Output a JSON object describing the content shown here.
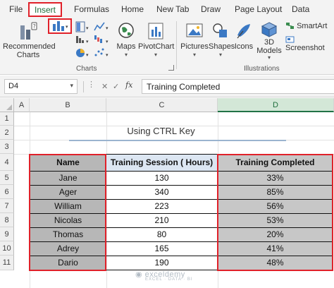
{
  "ribbon_tabs": [
    "File",
    "Insert",
    "Formulas",
    "Home",
    "New Tab",
    "Draw",
    "Page Layout",
    "Data"
  ],
  "active_tab": "Insert",
  "ribbon": {
    "recommended_charts_line1": "Recommended",
    "recommended_charts_line2": "Charts",
    "maps": "Maps",
    "pivotchart": "PivotChart",
    "charts_group": "Charts",
    "pictures": "Pictures",
    "shapes": "Shapes",
    "icons": "Icons",
    "models_3d_line1": "3D",
    "models_3d_line2": "Models",
    "smartart": "SmartArt",
    "screenshot": "Screenshot",
    "illustrations_group": "Illustrations"
  },
  "formula_bar": {
    "name_box": "D4",
    "formula": "Training Completed",
    "cancel_icon": "close-icon",
    "enter_icon": "check-icon",
    "fx_label": "fx"
  },
  "columns": [
    "A",
    "B",
    "C",
    "D"
  ],
  "rows": [
    "1",
    "2",
    "3",
    "4",
    "5",
    "6",
    "7",
    "8",
    "9",
    "10",
    "11"
  ],
  "selected_column": "D",
  "sheet": {
    "title": "Using CTRL Key",
    "headers": [
      "Name",
      "Training Session ( Hours)",
      "Training Completed"
    ],
    "records": [
      [
        "Jane",
        "130",
        "33%"
      ],
      [
        "Ager",
        "340",
        "85%"
      ],
      [
        "William",
        "223",
        "56%"
      ],
      [
        "Nicolas",
        "210",
        "53%"
      ],
      [
        "Thomas",
        "80",
        "20%"
      ],
      [
        "Adrey",
        "165",
        "41%"
      ],
      [
        "Dario",
        "190",
        "48%"
      ]
    ]
  },
  "watermark": {
    "brand": "exceldemy",
    "tagline": "EXCEL · DATA · BI"
  },
  "colors": {
    "highlight_red": "#e0212a",
    "excel_green": "#217346",
    "header_blue": "#dce6f2",
    "gray_fill": "#b7b7b7"
  }
}
